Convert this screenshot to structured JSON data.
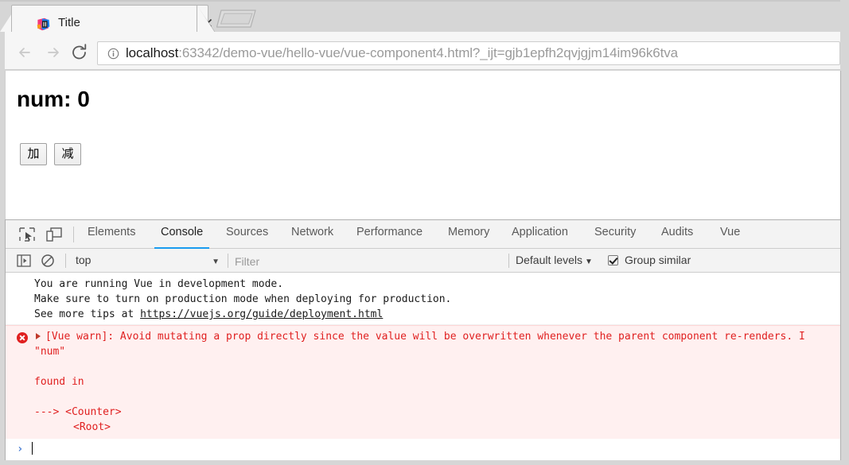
{
  "browser": {
    "tab": {
      "title": "Title",
      "favicon": "intellij-idea-favicon",
      "close_label": "×"
    },
    "new_tab_label": "",
    "nav": {
      "back_label": "←",
      "forward_label": "→",
      "reload_label": "⟳"
    },
    "omnibox": {
      "security_icon": "info-circle-icon",
      "host": "localhost",
      "rest": ":63342/demo-vue/hello-vue/vue-component4.html?_ijt=gjb1epfh2qvjgjm14im96k6tva",
      "full_url": "localhost:63342/demo-vue/hello-vue/vue-component4.html?_ijt=gjb1epfh2qvjgjm14im96k6tva"
    }
  },
  "page": {
    "heading": "num: 0",
    "buttons": {
      "add": "加",
      "subtract": "减"
    }
  },
  "devtools": {
    "icons": {
      "inspect": "inspect-element-icon",
      "device": "device-toolbar-icon",
      "sidebar": "console-sidebar-icon",
      "clear": "clear-console-icon"
    },
    "tabs": [
      {
        "label": "Elements",
        "active": false
      },
      {
        "label": "Console",
        "active": true
      },
      {
        "label": "Sources",
        "active": false
      },
      {
        "label": "Network",
        "active": false
      },
      {
        "label": "Performance",
        "active": false
      },
      {
        "label": "Memory",
        "active": false
      },
      {
        "label": "Application",
        "active": false
      },
      {
        "label": "Security",
        "active": false
      },
      {
        "label": "Audits",
        "active": false
      },
      {
        "label": "Vue",
        "active": false
      }
    ],
    "filterbar": {
      "context": "top",
      "context_arrow": "▼",
      "filter_placeholder": "Filter",
      "filter_value": "",
      "levels": "Default levels",
      "levels_arrow": "▼",
      "group_similar": "Group similar",
      "group_similar_checked": true
    },
    "console": {
      "info_message": {
        "line1": "You are running Vue in development mode.",
        "line2": "Make sure to turn on production mode when deploying for production.",
        "line3_prefix": "See more tips at ",
        "line3_link": "https://vuejs.org/guide/deployment.html"
      },
      "error_message": {
        "badge": "error-icon",
        "line1": "[Vue warn]: Avoid mutating a prop directly since the value will be overwritten whenever the parent component re-renders. I",
        "line2": "\"num\"",
        "line3": "found in",
        "line4": "---> <Counter>",
        "line5": "<Root>"
      },
      "prompt_arrow": "›"
    }
  },
  "colors": {
    "accent": "#1a9bf0",
    "error": "#e02020",
    "error_bg": "#fff0f0",
    "chrome_bg": "#d6d6d6",
    "toolbar_bg": "#f6f6f6"
  }
}
